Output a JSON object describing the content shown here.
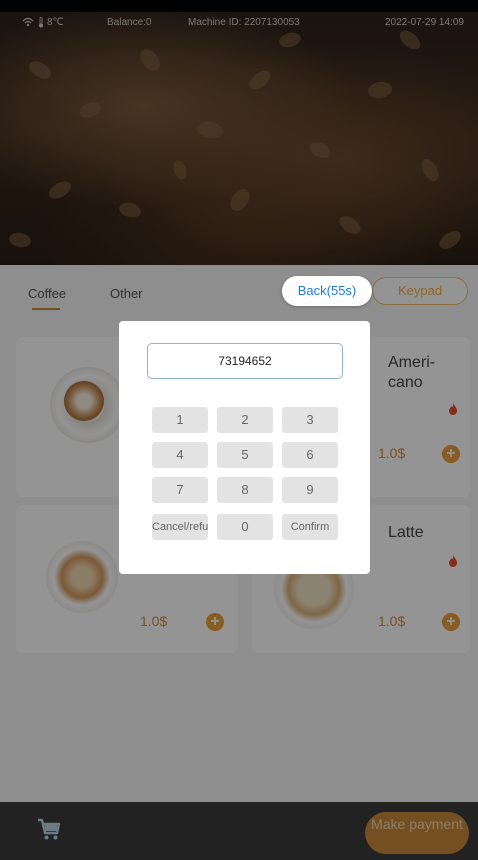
{
  "status": {
    "temperature": "8℃",
    "balance": "Balance:0",
    "machine_id": "Machine ID: 2207130053",
    "datetime": "2022-07-29 14:09"
  },
  "tabs": [
    {
      "label": "Coffee"
    },
    {
      "label": "Other"
    }
  ],
  "header": {
    "back_label": "Back(55s)",
    "keypad_label": "Keypad"
  },
  "products": [
    {
      "name": "",
      "price": ""
    },
    {
      "name": "Ameri-\ncano",
      "price": "1.0$"
    },
    {
      "name": "",
      "price": "1.0$"
    },
    {
      "name": "Latte",
      "price": "1.0$"
    }
  ],
  "dialog": {
    "code_value": "73194652",
    "keys": [
      "1",
      "2",
      "3",
      "4",
      "5",
      "6",
      "7",
      "8",
      "9",
      "Cancel/refu",
      "0",
      "Confirm"
    ]
  },
  "bottom": {
    "pay_label": "Make payment"
  },
  "colors": {
    "accent": "#e8a13a",
    "link": "#1f7ae0",
    "bar": "#3b3b3b"
  },
  "icons": [
    "wifi-icon",
    "cart-icon",
    "fire-icon",
    "plus-icon"
  ]
}
